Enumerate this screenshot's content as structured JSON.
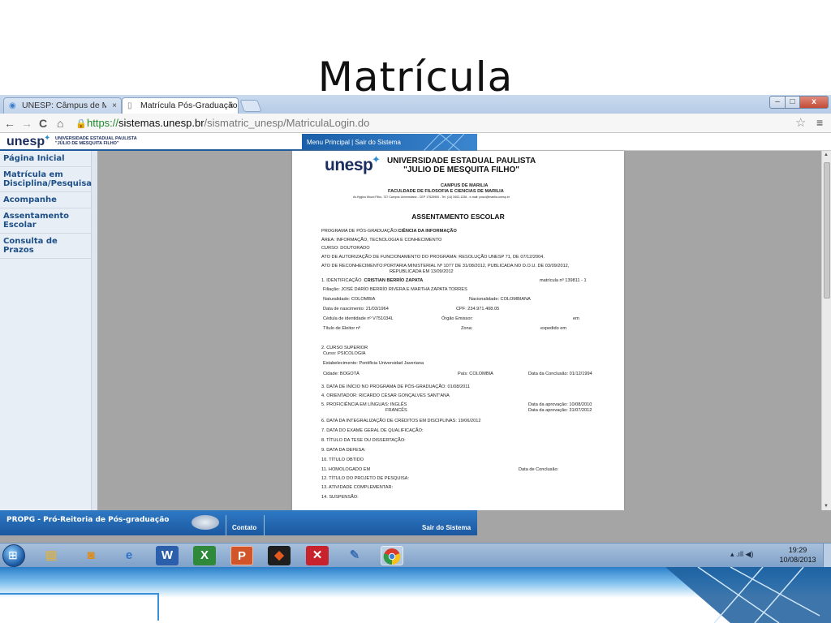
{
  "slide": {
    "title": "Matrícula"
  },
  "browser": {
    "tabs": [
      {
        "label": "UNESP: Câmpus de Marília",
        "close": "×"
      },
      {
        "label": "Matrícula Pós-Graduação",
        "close": "×"
      }
    ],
    "window_controls": {
      "minimize": "–",
      "maximize": "□",
      "close": "x"
    },
    "nav": {
      "back": "←",
      "forward": "→",
      "reload": "C",
      "home": "⌂"
    },
    "url": {
      "scheme": "https://",
      "host": "sistemas.unesp.br",
      "path": "/sismatric_unesp/MatriculaLogin.do"
    },
    "icons": {
      "star": "star-icon",
      "menu": "menu-icon",
      "lock": "lock-icon"
    }
  },
  "site": {
    "logo": "unesp",
    "logo_sub_line1": "UNIVERSIDADE ESTADUAL PAULISTA",
    "logo_sub_line2": "\"JÚLIO DE MESQUITA FILHO\"",
    "top_nav": "Menu Principal | Sair do Sistema",
    "sidebar": [
      {
        "label": "Página Inicial"
      },
      {
        "label": "Matrícula em Disciplina/Pesquisa"
      },
      {
        "label": "Acompanhe"
      },
      {
        "label": "Assentamento Escolar"
      },
      {
        "label": "Consulta de Prazos"
      }
    ],
    "footer": {
      "title": "PROPG - Pró-Reitoria de Pós-graduação",
      "contato": "Contato",
      "sair": "Sair do Sistema"
    }
  },
  "document": {
    "logo": "unesp",
    "university_line1": "UNIVERSIDADE ESTADUAL PAULISTA",
    "university_line2": "\"JULIO DE MESQUITA FILHO\"",
    "campus": "CAMPUS DE MARILIA",
    "faculty": "FACULDADE DE FILOSOFIA E CIENCIAS DE MARILIA",
    "address": "Av.Hygino Muzzi Filho, 737 Campus Universitário - CEP 17525900 - Tel. (14) 3402-1336 - e-mail: posci@marilia.unesp.br",
    "title": "ASSENTAMENTO ESCOLAR",
    "programa_label": "PROGRAMA DE PÓS-GRADUAÇÃO:",
    "programa": "CIÊNCIA DA INFORMAÇÃO",
    "area": "ÁREA: INFORMAÇÃO, TECNOLOGIA E CONHECIMENTO",
    "curso": "CURSO: DOUTORADO",
    "ato_autorizacao": "ATO DE AUTORIZAÇÃO DE FUNCIONAMENTO DO PROGRAMA: RESOLUÇÃO UNESP 71, DE 07/12/2004.",
    "ato_reconhecimento_1": "ATO DE RECONHECIMENTO:PORTARIA MINISTERIAL Nº 1077 DE 31/08/2012, PUBLICADA NO D.O.U. DE 03/09/2012,",
    "ato_reconhecimento_2": "REPUBLICADA EM 13/09/2012",
    "identificacao_label": "1. IDENTIFICAÇÃO",
    "nome": "CRISTIAN BERRÍO ZAPATA",
    "matricula": "matrícula nº 139811 - 1",
    "filiacao": "Filiação: JOSÉ DARÍO BERRÍO RIVERA E MARTHA ZAPATA TORRES",
    "naturalidade": "Naturalidade:   COLOMBIA",
    "nacionalidade": "Nacionalidade:   COLOMBIANA",
    "nascimento": "Data de nascimento:        21/03/1964",
    "cpf": "CPF:  234.971.408.05",
    "cedula": "Cédula de identidade nº   V751034L",
    "orgao": "Órgão Emissor:",
    "em": "em",
    "titulo_eleitor": "Título de Eleitor nº",
    "zona": "Zona:",
    "expedido": "expedido em",
    "curso_superior": "2. CURSO SUPERIOR",
    "curso_superior_nome": "Curso:  PSICOLOGIA",
    "estabelecimento": "Estabelecimento:   Pontificia Universidad Javeriana",
    "cidade": "Cidade:  BOGOTÁ",
    "pais": "País: COLOMBIA",
    "conclusao": "Data da Conclusão:   01/12/1994",
    "item3": "3. DATA DE INÍCIO NO PROGRAMA DE PÓS-GRADUAÇÃO:        01/08/2011",
    "item4": "4. ORIENTADOR: RICARDO CÉSAR GONÇALVES SANT'ANA",
    "item5": "5. PROFICIÊNCIA EM LÍNGUAS:  INGLÊS",
    "item5b": "FRANCÊS",
    "aprov1": "Data da aprovação:   10/08/2010",
    "aprov2": "Data da aprovação:   31/07/2012",
    "item6": "6. DATA DA INTEGRALIZAÇÃO DE CRÉDITOS EM DISCIPLINAS:  19/06/2012",
    "item7": "7. DATA DO EXAME GERAL DE QUALIFICAÇÃO:",
    "item8": "8. TÍTULO DA TESE OU DISSERTAÇÃO:",
    "item9": "9. DATA DA DEFESA:",
    "item10": "10. TÍTULO OBTIDO",
    "item11": "11. HOMOLOGADO EM",
    "item11b": "Data de Conclusão:",
    "item12": "12. TÍTULO DO PROJETO DE PESQUISA:",
    "item13": "13. ATIVIDADE COMPLEMENTAR:",
    "item14": "14. SUSPENSÃO:"
  },
  "taskbar": {
    "time": "19:29",
    "date": "10/08/2013",
    "apps": [
      "start-orb",
      "explorer-icon",
      "outlook-icon",
      "ie-icon",
      "word-icon",
      "excel-icon",
      "powerpoint-icon",
      "acrobat-icon",
      "pdf-icon",
      "paint-icon",
      "chrome-icon"
    ]
  }
}
